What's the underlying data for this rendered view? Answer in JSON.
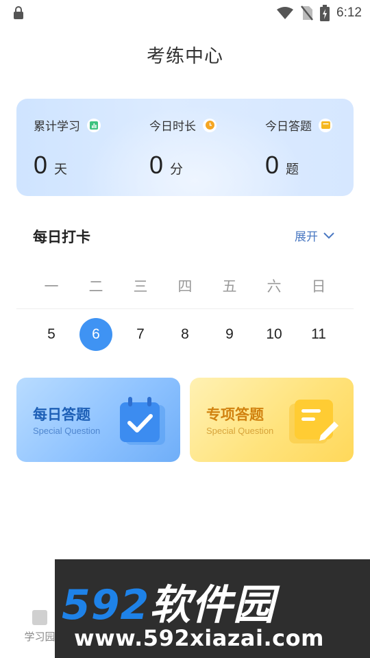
{
  "status_bar": {
    "time": "6:12",
    "icons": [
      "lock-icon",
      "wifi-icon",
      "no-sim-icon",
      "battery-charging-icon"
    ]
  },
  "title": "考练中心",
  "stats": [
    {
      "label": "累计学习",
      "value": "0",
      "unit": "天",
      "icon": "chart-icon",
      "icon_color": "#3ec27f"
    },
    {
      "label": "今日时长",
      "value": "0",
      "unit": "分",
      "icon": "clock-icon",
      "icon_color": "#f5a623"
    },
    {
      "label": "今日答题",
      "value": "0",
      "unit": "题",
      "icon": "card-icon",
      "icon_color": "#f5b821"
    }
  ],
  "checkin": {
    "title": "每日打卡",
    "expand_label": "展开",
    "weekdays": [
      "一",
      "二",
      "三",
      "四",
      "五",
      "六",
      "日"
    ],
    "dates": [
      "5",
      "6",
      "7",
      "8",
      "9",
      "10",
      "11"
    ],
    "selected_date": "6"
  },
  "cards": [
    {
      "title": "每日答题",
      "subtitle": "Special Question",
      "icon": "calendar-check-icon"
    },
    {
      "title": "专项答题",
      "subtitle": "Special Question",
      "icon": "note-edit-icon"
    }
  ],
  "bottom_nav": {
    "visible_item": "学习园"
  },
  "watermark": {
    "logo_number": "592",
    "logo_text": "软件园",
    "url": "www.592xiazai.com"
  },
  "colors": {
    "accent": "#3f93f3",
    "link": "#4a78c2",
    "stats_card": "#d6e7ff",
    "daily_card": "#8fc3ff",
    "special_card": "#ffe37d"
  }
}
